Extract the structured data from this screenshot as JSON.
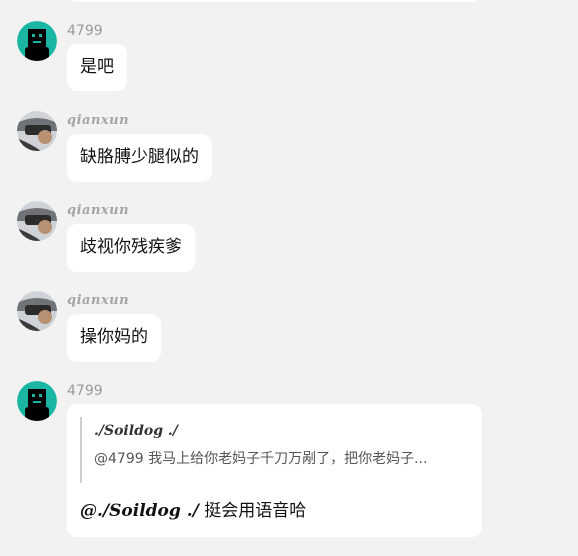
{
  "messages": [
    {
      "username": "4799",
      "text": "是吧"
    },
    {
      "username": "qianxun",
      "text": "缺胳膊少腿似的"
    },
    {
      "username": "qianxun",
      "text": "歧视你残疾爹"
    },
    {
      "username": "qianxun",
      "text": "操你妈的"
    },
    {
      "username": "4799",
      "quote": {
        "author": "./Soildog ./",
        "text": "@4799 我马上给你老妈子千刀万剐了，把你老妈子..."
      },
      "mention": "@./Soildog ./",
      "text": " 挺会用语音哈"
    }
  ],
  "colors": {
    "background": "#f2f2f2",
    "bubble": "#ffffff",
    "teal_avatar": "#1ab6a3"
  },
  "icons": {
    "robot_avatar": "robot-avatar-icon",
    "photo_avatar": "user-photo-avatar"
  }
}
